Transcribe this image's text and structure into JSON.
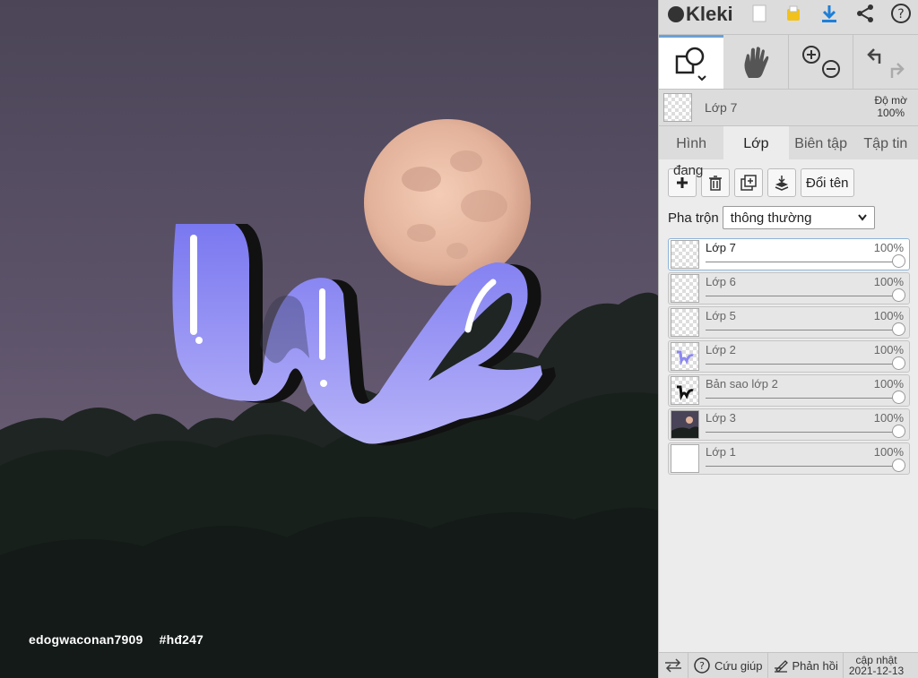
{
  "canvas": {
    "watermark": [
      "edogwaconan7909",
      "#hđ247"
    ]
  },
  "topbar": {
    "logo": "Kleki",
    "icons": [
      "new-file-icon",
      "save-icon",
      "download-icon",
      "share-icon",
      "help-icon"
    ]
  },
  "tools": [
    "shape-tool-icon",
    "hand-tool-icon",
    "zoom-icon",
    "undo-redo-icon"
  ],
  "layer_header": {
    "name": "Lớp 7",
    "opacity_label": "Độ mờ",
    "opacity_value": "100%"
  },
  "tabs": [
    "Hình",
    "Lớp",
    "Biên tập",
    "Tập tin"
  ],
  "active_tab": "Lớp",
  "layer_buttons": {
    "overlay_text": "đang",
    "rename": "Đổi tên"
  },
  "blend": {
    "label": "Pha trộn",
    "value": "thông thường"
  },
  "layers": [
    {
      "name": "Lớp 7",
      "opacity": "100%",
      "selected": true
    },
    {
      "name": "Lớp 6",
      "opacity": "100%"
    },
    {
      "name": "Lớp 5",
      "opacity": "100%"
    },
    {
      "name": "Lớp 2",
      "opacity": "100%"
    },
    {
      "name": "Bản sao lớp 2",
      "opacity": "100%"
    },
    {
      "name": "Lớp 3",
      "opacity": "100%"
    },
    {
      "name": "Lớp 1",
      "opacity": "100%"
    }
  ],
  "bottombar": {
    "help": "Cứu giúp",
    "feedback": "Phản hồi",
    "update_line1": "cập nhật",
    "update_line2": "2021-12-13"
  }
}
